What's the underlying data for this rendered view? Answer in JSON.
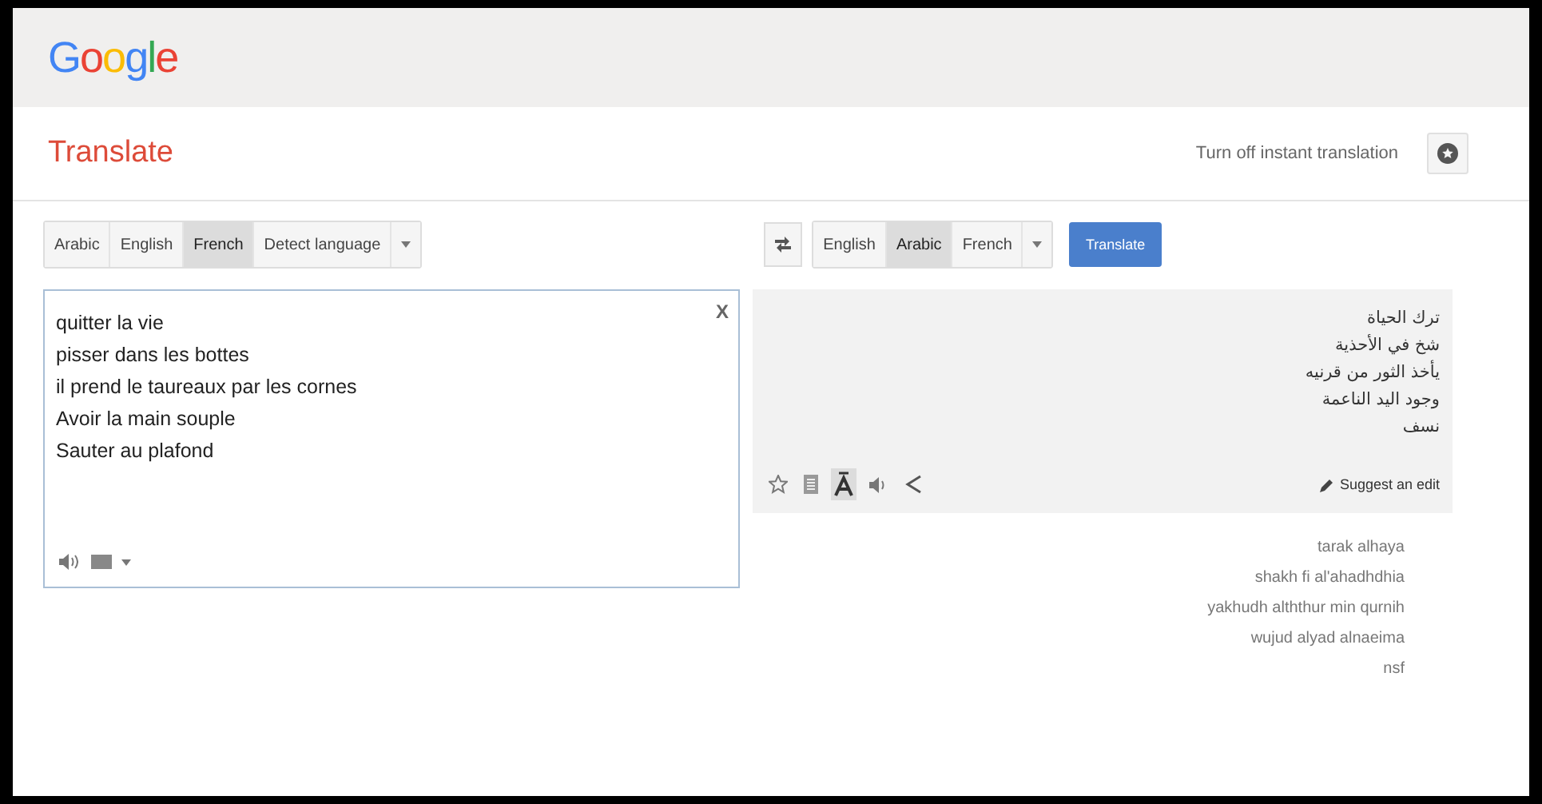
{
  "header": {
    "logo": "Google"
  },
  "title_bar": {
    "title": "Translate",
    "instant_toggle": "Turn off instant translation"
  },
  "source_languages": [
    {
      "label": "Arabic",
      "selected": false
    },
    {
      "label": "English",
      "selected": false
    },
    {
      "label": "French",
      "selected": true
    },
    {
      "label": "Detect language",
      "selected": false
    }
  ],
  "target_languages": [
    {
      "label": "English",
      "selected": false
    },
    {
      "label": "Arabic",
      "selected": true
    },
    {
      "label": "French",
      "selected": false
    }
  ],
  "translate_button": "Translate",
  "source": {
    "clear": "X",
    "lines": [
      "quitter la vie",
      "pisser dans les bottes",
      "il prend le taureaux par les cornes",
      "Avoir la main souple",
      "Sauter au plafond"
    ]
  },
  "result": {
    "lines": [
      "ترك الحياة",
      "شخ في الأحذية",
      "يأخذ الثور من قرنيه",
      "وجود اليد الناعمة",
      "نسف"
    ],
    "suggest": "Suggest an edit",
    "romanization": [
      "tarak alhaya",
      "shakh fi al'ahadhdhia",
      "yakhudh alththur min qurnih",
      "wujud alyad alnaeima",
      "nsf"
    ]
  }
}
